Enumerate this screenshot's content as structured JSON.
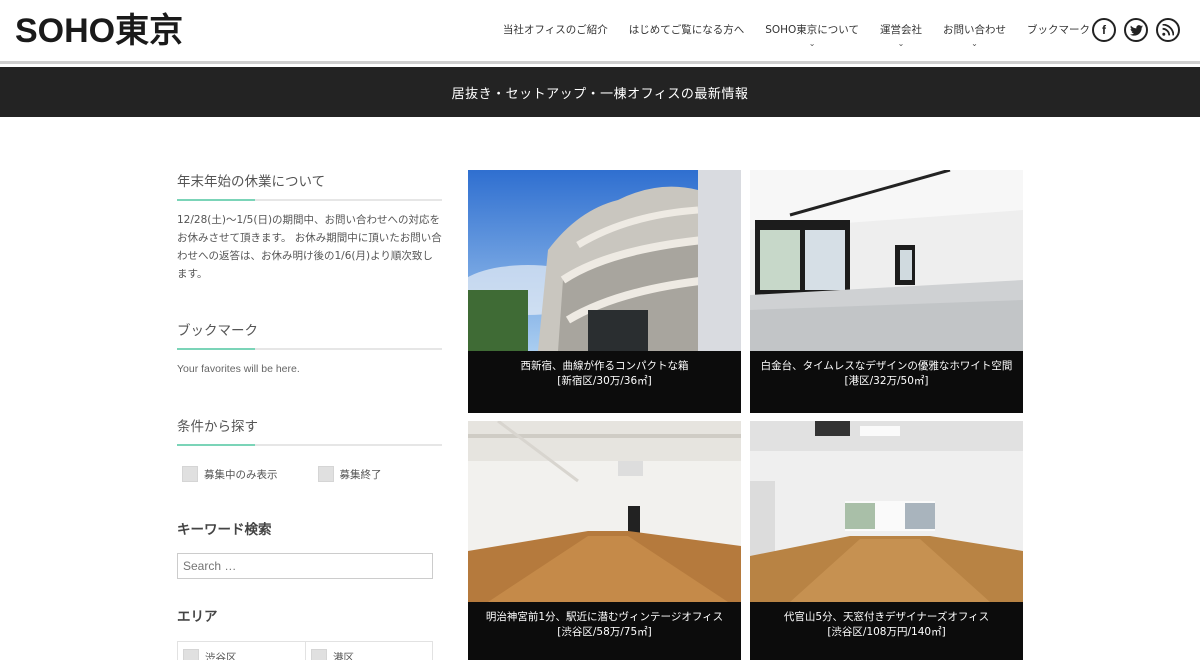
{
  "header": {
    "logo": "SOHO東京",
    "nav": [
      {
        "label": "当社オフィスのご紹介",
        "dropdown": false
      },
      {
        "label": "はじめてご覧になる方へ",
        "dropdown": false
      },
      {
        "label": "SOHO東京について",
        "dropdown": true
      },
      {
        "label": "運営会社",
        "dropdown": true
      },
      {
        "label": "お問い合わせ",
        "dropdown": true
      },
      {
        "label": "ブックマーク",
        "dropdown": false
      }
    ],
    "social": [
      "facebook-icon",
      "twitter-icon",
      "rss-icon"
    ],
    "chevron": "⌄"
  },
  "banner": {
    "text": "居抜き・セットアップ・一棟オフィスの最新情報"
  },
  "sidebar": {
    "notice": {
      "title": "年末年始の休業について",
      "body": "12/28(土)〜1/5(日)の期間中、お問い合わせへの対応をお休みさせて頂きます。 お休み期間中に頂いたお問い合わせへの返答は、お休み明け後の1/6(月)より順次致します。"
    },
    "bookmark": {
      "title": "ブックマーク",
      "text": "Your favorites will be here."
    },
    "conditions": {
      "title": "条件から探す",
      "options": [
        "募集中のみ表示",
        "募集終了"
      ]
    },
    "keyword": {
      "title": "キーワード検索",
      "placeholder": "Search …"
    },
    "area": {
      "title": "エリア",
      "options": [
        "渋谷区",
        "港区"
      ]
    }
  },
  "listings": [
    {
      "title": "西新宿、曲線が作るコンパクトな箱",
      "detail": "[新宿区/30万/36㎡]"
    },
    {
      "title": "白金台、タイムレスなデザインの優雅なホワイト空間",
      "detail": "[港区/32万/50㎡]"
    },
    {
      "title": "明治神宮前1分、駅近に潜むヴィンテージオフィス",
      "detail": "[渋谷区/58万/75㎡]"
    },
    {
      "title": "代官山5分、天窓付きデザイナーズオフィス",
      "detail": "[渋谷区/108万円/140㎡]"
    }
  ],
  "colors": {
    "accent": "#7bd4b8",
    "banner_bg": "#232323",
    "caption_bg": "#0c0c0c"
  }
}
